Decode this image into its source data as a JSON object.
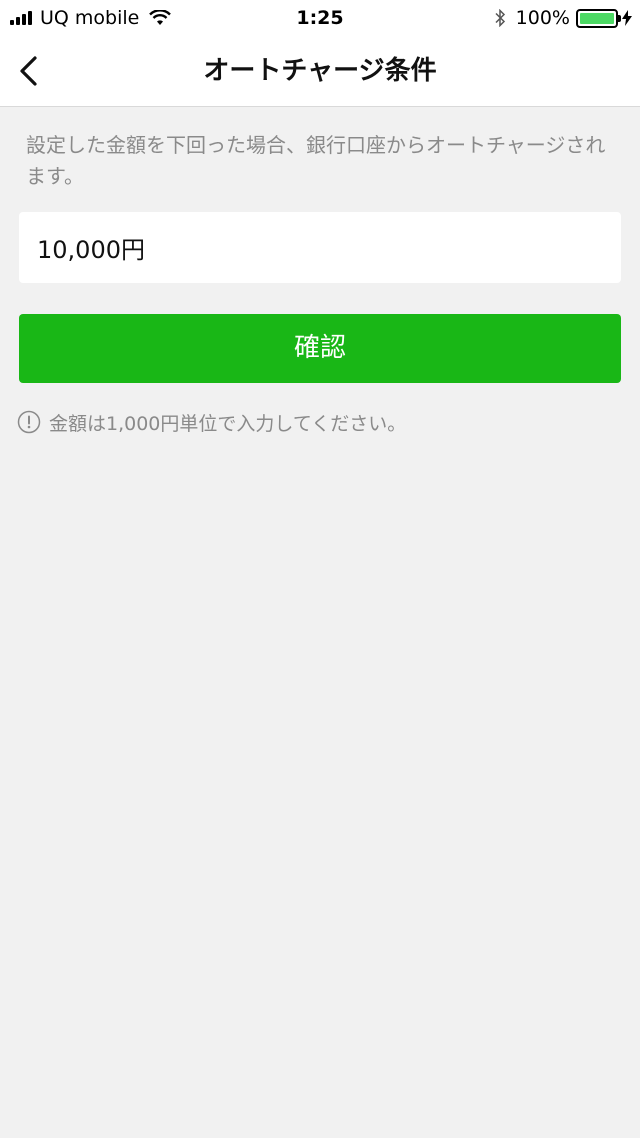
{
  "status_bar": {
    "carrier": "UQ mobile",
    "time": "1:25",
    "battery_percent": "100%",
    "battery_level": 1.0,
    "icons": [
      "signal-icon",
      "wifi-icon",
      "bluetooth-icon",
      "battery-icon",
      "charging-icon"
    ]
  },
  "nav": {
    "title": "オートチャージ条件",
    "back_icon": "chevron-left-icon"
  },
  "description": "設定した金額を下回った場合、銀行口座からオートチャージされます。",
  "amount_field": {
    "value": "10,000円"
  },
  "confirm_button": {
    "label": "確認"
  },
  "notice": {
    "icon": "exclamation-circle-icon",
    "text": "金額は1,000円単位で入力してください。"
  },
  "colors": {
    "accent_green": "#19b716",
    "background": "#f1f1f1",
    "hint_text": "#8a8a8a"
  }
}
